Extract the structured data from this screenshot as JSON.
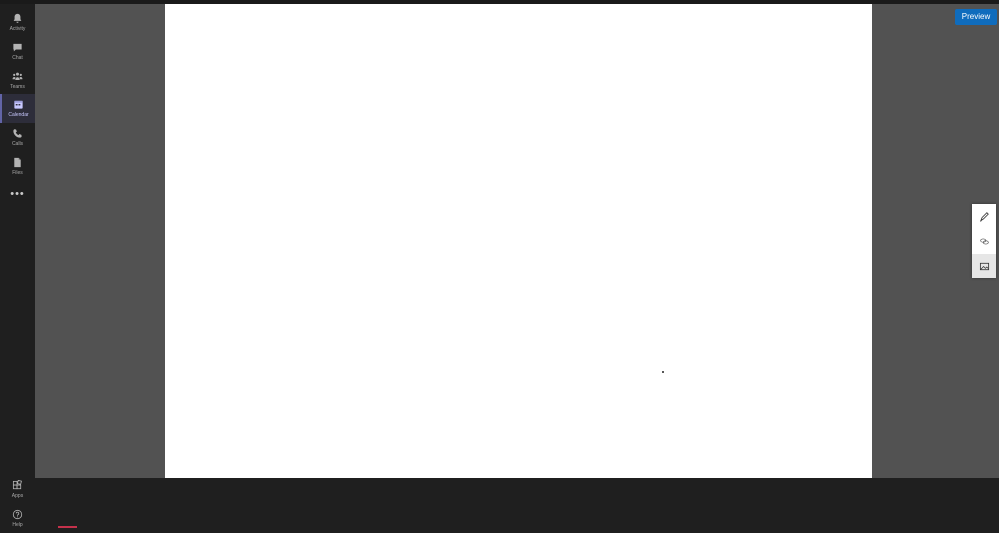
{
  "rail": {
    "items": [
      {
        "label": "Activity",
        "icon": "bell-icon"
      },
      {
        "label": "Chat",
        "icon": "chat-icon"
      },
      {
        "label": "Teams",
        "icon": "teams-icon"
      },
      {
        "label": "Calendar",
        "icon": "calendar-icon",
        "active": true
      },
      {
        "label": "Calls",
        "icon": "phone-icon"
      },
      {
        "label": "Files",
        "icon": "file-icon"
      }
    ],
    "more": "•••",
    "bottom_items": [
      {
        "label": "Apps",
        "icon": "apps-icon"
      },
      {
        "label": "Help",
        "icon": "help-icon"
      }
    ]
  },
  "toolbar": {
    "preview_label": "Preview"
  },
  "tools": [
    {
      "icon": "pen-icon"
    },
    {
      "icon": "link-icon"
    },
    {
      "icon": "image-icon",
      "active": true
    }
  ],
  "colors": {
    "rail_bg": "#1f1f1f",
    "stage_bg": "#525252",
    "accent": "#6264a7",
    "preview_button": "#0f6cbd"
  }
}
